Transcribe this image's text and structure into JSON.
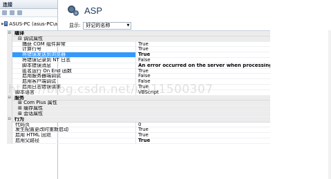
{
  "left": {
    "header": "连接",
    "tree_item": "ASUS-PC (asus-PC\\a"
  },
  "main": {
    "title": "ASP",
    "display_label": "显示:",
    "display_value": "好记的名称"
  },
  "grid": [
    {
      "kind": "cat",
      "toggle": "⊟",
      "name": "编译",
      "value": ""
    },
    {
      "kind": "sub",
      "toggle": "⊟",
      "name": "调试属性",
      "value": ""
    },
    {
      "kind": "prop",
      "name": "捕获 COM 组件异常",
      "value": "True"
    },
    {
      "kind": "prop",
      "name": "计算行号",
      "value": "True"
    },
    {
      "kind": "prop sel",
      "name": "将错误发送到浏览器",
      "value": "True",
      "bold": true
    },
    {
      "kind": "prop",
      "name": "将错误记录到 NT 日志",
      "value": "False"
    },
    {
      "kind": "prop",
      "name": "脚本错误消息",
      "value": "An error occurred on the server when processing the URL. Ple",
      "bold": true
    },
    {
      "kind": "prop",
      "name": "匿名运行 On End 函数",
      "value": "True"
    },
    {
      "kind": "prop",
      "name": "启用服务器端调试",
      "value": "False"
    },
    {
      "kind": "prop",
      "name": "启用客户端调试",
      "value": "False"
    },
    {
      "kind": "prop",
      "name": "启用日志错误请求",
      "value": "True"
    },
    {
      "kind": "prop2",
      "name": "脚本语言",
      "value": "VBScript"
    },
    {
      "kind": "cat",
      "toggle": "⊟",
      "name": "服务",
      "value": ""
    },
    {
      "kind": "sub",
      "toggle": "⊞",
      "name": "Com Plus 属性",
      "value": ""
    },
    {
      "kind": "sub",
      "toggle": "⊞",
      "name": "缓存属性",
      "value": ""
    },
    {
      "kind": "sub",
      "toggle": "⊞",
      "name": "会话属性",
      "value": ""
    },
    {
      "kind": "cat",
      "toggle": "⊟",
      "name": "行为",
      "value": ""
    },
    {
      "kind": "prop2",
      "name": "代码页",
      "value": "0"
    },
    {
      "kind": "prop2",
      "name": "发生配置更改时重新启动",
      "value": "True"
    },
    {
      "kind": "prop2",
      "name": "启用 HTML 回退",
      "value": "True"
    },
    {
      "kind": "prop2",
      "name": "启用父路径",
      "value": "True",
      "bold": true
    }
  ],
  "watermark": "http://blog.csdn.net/u011500307"
}
